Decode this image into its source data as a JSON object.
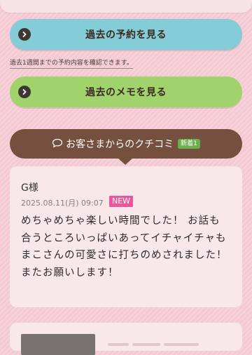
{
  "buttons": {
    "past_reservation": "過去の予約を見る",
    "past_memo": "過去のメモを見る"
  },
  "reservation_note": "過去1週間までの予約内容を確認できます。",
  "reviews_section": {
    "title": "お客さまからのクチコミ",
    "new_count_badge": "新着1",
    "icon": "speech-bubble-icon"
  },
  "review": {
    "name": "G様",
    "date": "2025.08.11(月) 09:07",
    "badge": "NEW",
    "body": "めちゃめちゃ楽しい時間でした！ お話も合うところいっぱいあってイチャイチャもまこさんの可愛さに打ちのめされました！ またお願いします！"
  },
  "colors": {
    "background": "#f4c9d2",
    "reservation_button": "#84ccd6",
    "memo_button": "#a1d36d",
    "header": "#75503e",
    "new_badge": "#e9589a",
    "new_count_badge": "#6bb04d",
    "card": "#f8e8ea"
  }
}
